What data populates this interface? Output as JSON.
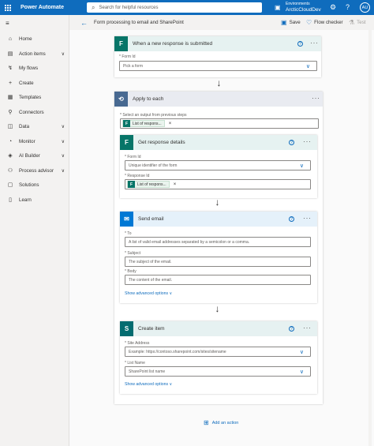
{
  "topbar": {
    "app_title": "Power Automate",
    "search_placeholder": "Search for helpful resources",
    "env_label": "Environments",
    "env_name": "ArcticCloudDev",
    "avatar": "AU",
    "color": "#0f6cbd"
  },
  "sidebar": {
    "items": [
      {
        "label": "Home",
        "icon": "home-icon",
        "chevron": false
      },
      {
        "label": "Action items",
        "icon": "clipboard-icon",
        "chevron": true
      },
      {
        "label": "My flows",
        "icon": "flows-icon",
        "chevron": false
      },
      {
        "label": "Create",
        "icon": "plus-icon",
        "chevron": false
      },
      {
        "label": "Templates",
        "icon": "templates-icon",
        "chevron": false
      },
      {
        "label": "Connectors",
        "icon": "connector-icon",
        "chevron": false
      },
      {
        "label": "Data",
        "icon": "database-icon",
        "chevron": true
      },
      {
        "label": "Monitor",
        "icon": "monitor-icon",
        "chevron": true
      },
      {
        "label": "AI Builder",
        "icon": "ai-builder-icon",
        "chevron": true
      },
      {
        "label": "Process advisor",
        "icon": "process-advisor-icon",
        "chevron": true
      },
      {
        "label": "Solutions",
        "icon": "solutions-icon",
        "chevron": false
      },
      {
        "label": "Learn",
        "icon": "book-icon",
        "chevron": false
      }
    ]
  },
  "subheader": {
    "flow_name": "Form processing to email and SharePoint",
    "save": "Save",
    "flow_checker": "Flow checker",
    "test": "Test"
  },
  "trigger": {
    "title": "When a new response is submitted",
    "color": "#077568",
    "form_id_label": "Form Id",
    "form_id_placeholder": "Pick a form"
  },
  "apply": {
    "title": "Apply to each",
    "color": "#486991",
    "select_label": "Select an output from previous steps",
    "token": "List of respons...",
    "get_response": {
      "title": "Get response details",
      "form_id_label": "Form Id",
      "form_id_placeholder": "Unique identifier of the form",
      "response_id_label": "Response Id",
      "token": "List of respons..."
    },
    "send_email": {
      "title": "Send email",
      "color": "#0078d4",
      "to_label": "To",
      "to_placeholder": "A list of valid email addresses separated by a semicolon or a comma.",
      "subject_label": "Subject",
      "subject_placeholder": "The subject of the email.",
      "body_label": "Body",
      "body_placeholder": "The content of the email.",
      "advanced": "Show advanced options"
    },
    "create_item": {
      "title": "Create item",
      "color": "#036c70",
      "site_label": "Site Address",
      "site_placeholder": "Example: https://contoso.sharepoint.com/sites/sitename",
      "list_label": "List Name",
      "list_placeholder": "SharePoint list name",
      "advanced": "Show advanced options"
    }
  },
  "add_action": "Add an action"
}
